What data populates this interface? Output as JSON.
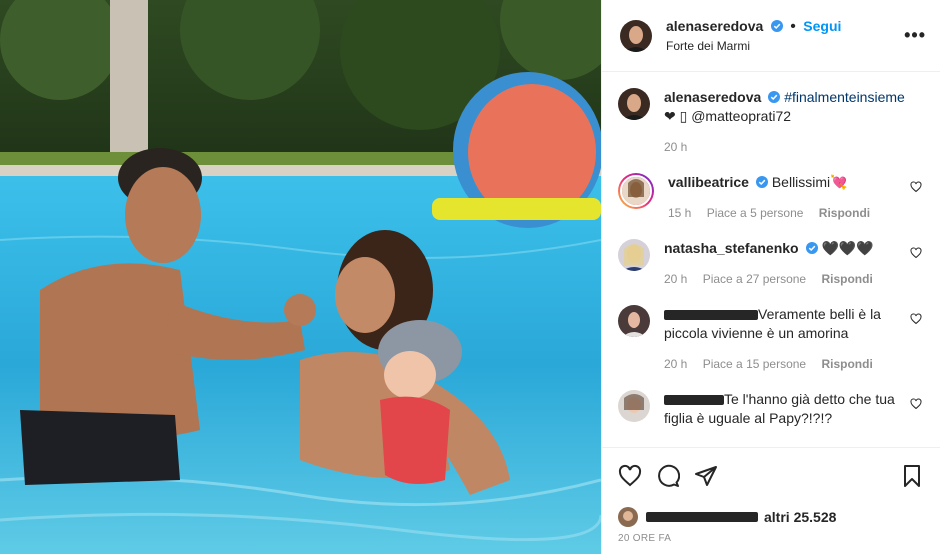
{
  "post": {
    "author": "alenaseredova",
    "follow_label": "Segui",
    "location": "Forte dei Marmi",
    "caption_user": "alenaseredova",
    "caption_hashtag": "#finalmenteinsieme",
    "caption_rest": "❤ ▯ @matteoprati72",
    "caption_time": "20 h",
    "more_label": "•••"
  },
  "comments": [
    {
      "user": "vallibeatrice",
      "text": "Bellissimi💘",
      "time": "15 h",
      "likes": "Piace a 5 persone",
      "reply": "Rispondi"
    },
    {
      "user": "natasha_stefanenko",
      "text": "🖤🖤🖤",
      "time": "20 h",
      "likes": "Piace a 27 persone",
      "reply": "Rispondi"
    },
    {
      "user": "",
      "text": "Veramente belli è la piccola vivienne è un amorina",
      "time": "20 h",
      "likes": "Piace a 15 persone",
      "reply": "Rispondi"
    },
    {
      "user": "",
      "text": "Te l'hanno già detto che tua figlia è uguale al Papy?!?!?",
      "time": "",
      "likes": "",
      "reply": ""
    }
  ],
  "likes_summary": {
    "others": "altri 25.528"
  },
  "timestamp": "20 ORE FA",
  "icons": {
    "verified": "verified-badge-icon",
    "like": "heart-icon",
    "comment": "comment-icon",
    "share": "paper-plane-icon",
    "save": "bookmark-icon",
    "more": "more-dots-icon"
  },
  "colors": {
    "accent": "#0095f6",
    "verified": "#3897f0",
    "pool": "#2fb3e0"
  }
}
